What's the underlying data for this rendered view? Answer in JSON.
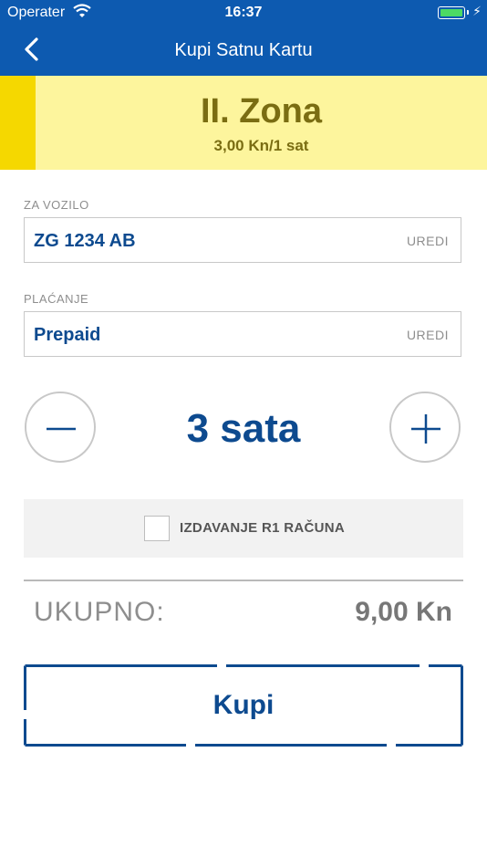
{
  "status_bar": {
    "carrier": "Operater",
    "time": "16:37"
  },
  "nav": {
    "title": "Kupi Satnu Kartu"
  },
  "zone": {
    "name": "II. Zona",
    "rate": "3,00 Kn/1 sat",
    "colors": {
      "stripe": "#f5d800",
      "background": "#fdf59d",
      "text": "#7a6d12"
    }
  },
  "vehicle": {
    "label": "ZA VOZILO",
    "value": "ZG 1234 AB",
    "edit_label": "UREDI"
  },
  "payment": {
    "label": "PLAĆANJE",
    "value": "Prepaid",
    "edit_label": "UREDI"
  },
  "duration": {
    "value": "3 sata"
  },
  "r1_invoice": {
    "label": "IZDAVANJE R1 RAČUNA",
    "checked": false
  },
  "total": {
    "label": "UKUPNO:",
    "value": "9,00 Kn"
  },
  "buy_button": {
    "label": "Kupi"
  },
  "colors": {
    "primary": "#0d5ab0",
    "accent_text": "#0d4a8f"
  }
}
